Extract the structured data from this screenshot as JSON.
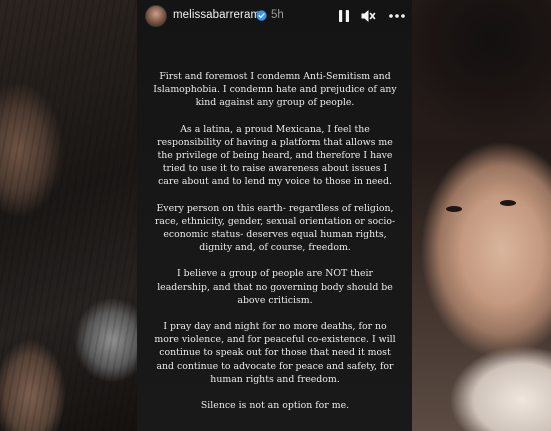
{
  "story": {
    "username": "melissabarreram",
    "time": "5h",
    "verified": true,
    "icons": {
      "avatar": "profile-avatar",
      "verified": "verified-badge-icon",
      "pause": "pause-icon",
      "mute": "muted-speaker-icon",
      "more": "more-options-icon"
    },
    "paragraphs": [
      "First and foremost I condemn Anti-Semitism and Islamophobia. I condemn hate and prejudice of any kind against any group of people.",
      "As a latina, a proud Mexicana, I feel the responsibility of having a platform that allows me the privilege of being heard, and therefore I have tried to use it to raise awareness about issues I care about and to lend my voice to those in need.",
      "Every person on this earth- regardless of religion, race, ethnicity, gender, sexual orientation or socio-economic status- deserves equal human rights, dignity and, of course, freedom.",
      "I believe a group of people are NOT their leadership, and that no governing body should be above criticism.",
      "I pray day and night for no more deaths, for no more violence, and for peaceful co-existence. I will continue to speak out for those that need it most and continue to advocate for peace and safety, for human rights and freedom.",
      "Silence is not an option for me."
    ]
  },
  "colors": {
    "story_background": "#171717",
    "text": "#ececec",
    "verified_badge": "#3897f0",
    "time_text": "#9a9a9a"
  }
}
